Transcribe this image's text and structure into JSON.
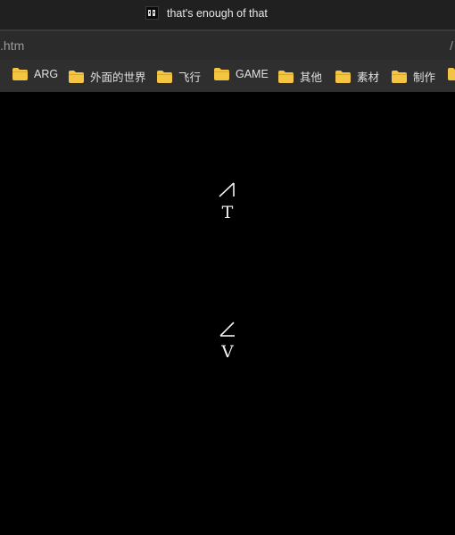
{
  "window": {
    "title": "that's enough of that"
  },
  "address_bar": {
    "visible_text": ".htm",
    "trailing_text": "/"
  },
  "bookmarks": [
    {
      "label": "ARG",
      "icon": "folder-icon"
    },
    {
      "label": "外面的世界",
      "icon": "folder-icon"
    },
    {
      "label": "飞行",
      "icon": "folder-icon"
    },
    {
      "label": "GAME",
      "icon": "folder-icon"
    },
    {
      "label": "其他",
      "icon": "folder-icon"
    },
    {
      "label": "素材",
      "icon": "folder-icon"
    },
    {
      "label": "制作",
      "icon": "folder-icon"
    }
  ],
  "content": {
    "items": [
      {
        "letter": "T",
        "symbol": "rising-slash-with-vertical"
      },
      {
        "letter": "V",
        "symbol": "angle"
      }
    ]
  },
  "colors": {
    "titlebar_bg": "#202020",
    "addressbar_bg": "#2b2b2b",
    "bookmarks_bg": "#2f2f2f",
    "page_bg": "#000000",
    "folder_yellow": "#f4c542",
    "glyph_color": "#f2f2f2"
  }
}
